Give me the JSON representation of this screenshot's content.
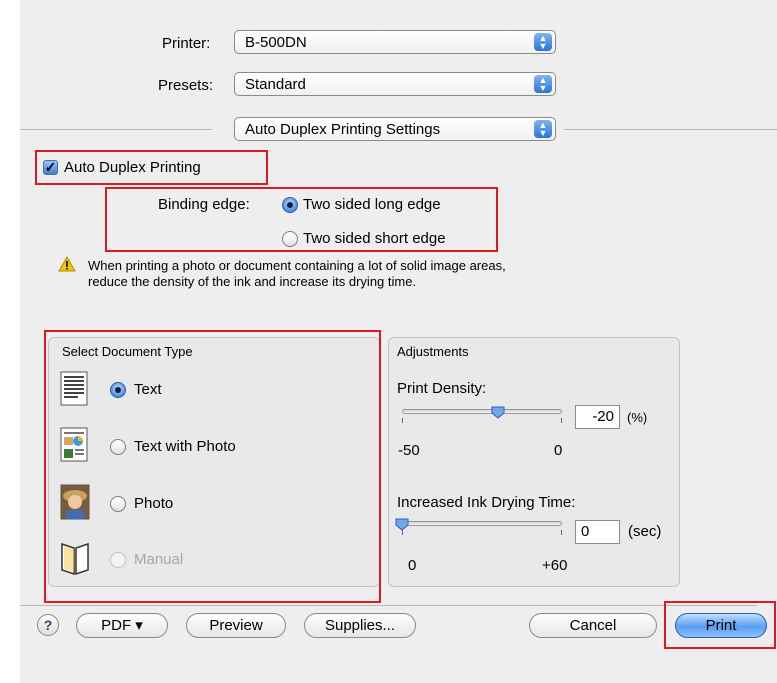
{
  "printer": {
    "label": "Printer:",
    "value": "B-500DN"
  },
  "presets": {
    "label": "Presets:",
    "value": "Standard"
  },
  "panel_menu": {
    "value": "Auto Duplex Printing Settings"
  },
  "auto_duplex": {
    "label": "Auto Duplex Printing",
    "checked": true
  },
  "binding": {
    "label": "Binding edge:",
    "options": [
      {
        "label": "Two sided long edge",
        "selected": true
      },
      {
        "label": "Two sided short edge",
        "selected": false
      }
    ]
  },
  "warning": {
    "line1": "When printing a photo or document containing a lot of solid image areas,",
    "line2": "reduce the density of the ink and increase its drying time."
  },
  "document_type": {
    "title": "Select Document Type",
    "options": [
      {
        "label": "Text",
        "selected": true,
        "icon": "text-document-icon"
      },
      {
        "label": "Text with Photo",
        "selected": false,
        "icon": "text-with-photo-document-icon"
      },
      {
        "label": "Photo",
        "selected": false,
        "icon": "photo-document-icon"
      },
      {
        "label": "Manual",
        "selected": false,
        "disabled": true,
        "icon": "manual-book-icon"
      }
    ]
  },
  "adjustments": {
    "title": "Adjustments",
    "print_density": {
      "label": "Print Density:",
      "value": "-20",
      "unit": "(%)",
      "min_label": "-50",
      "max_label": "0",
      "min": -50,
      "max": 0,
      "current": -20
    },
    "drying_time": {
      "label": "Increased Ink Drying Time:",
      "value": "0",
      "unit": "(sec)",
      "min_label": "0",
      "max_label": "+60",
      "min": 0,
      "max": 60,
      "current": 0
    }
  },
  "buttons": {
    "help": "?",
    "pdf": "PDF ▾",
    "preview": "Preview",
    "supplies": "Supplies...",
    "cancel": "Cancel",
    "print": "Print"
  },
  "colors": {
    "highlight_box": "#e0181f",
    "accent": "#3c80d8"
  }
}
